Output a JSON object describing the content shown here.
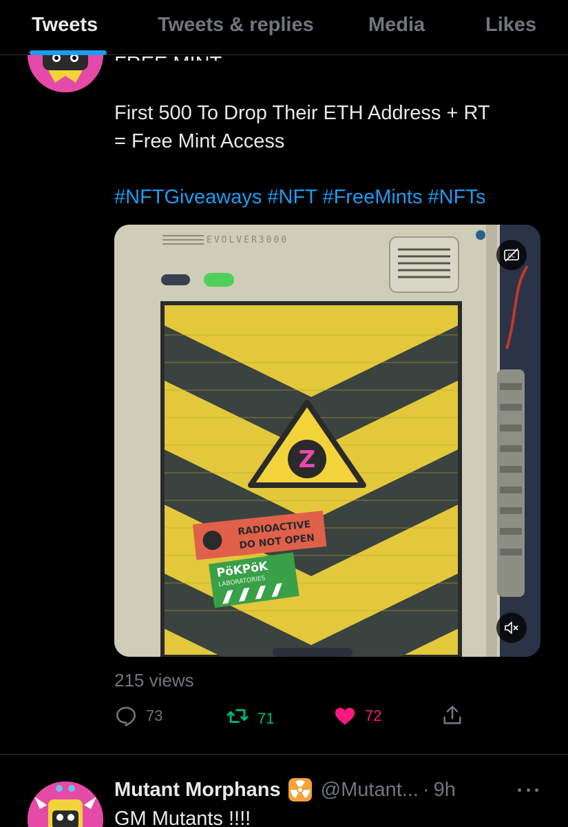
{
  "tabs": [
    {
      "label": "Tweets",
      "active": true
    },
    {
      "label": "Tweets & replies",
      "active": false
    },
    {
      "label": "Media",
      "active": false
    },
    {
      "label": "Likes",
      "active": false
    }
  ],
  "tweet1": {
    "clipped_title": "FREE MINT",
    "text_line1": "First 500 To Drop Their ETH Address + RT",
    "text_line2": "= Free Mint Access",
    "hashtags": [
      "#NFTGiveaways",
      "#NFT",
      "#FreeMints",
      "#NFTs"
    ],
    "media": {
      "header_text": "EVOLVER3000",
      "sticker_line1": "RADIOACTIVE",
      "sticker_line2": "DO NOT OPEN",
      "lab_label": "PöKPöK",
      "lab_sub": "LABORATORIES",
      "emblem_letter": "Z",
      "cc_icon": "closed-captions-icon",
      "mute_icon": "speaker-muted-icon"
    },
    "views": "215 views",
    "replies": "73",
    "retweets": "71",
    "likes": "72",
    "colors": {
      "retweeted": "#00ba7c",
      "liked": "#f91880",
      "link": "#1d9bf0"
    }
  },
  "tweet2": {
    "name": "Mutant Morphans",
    "handle": "@Mutant...",
    "separator": "·",
    "time": "9h",
    "text": "GM Mutants !!!!"
  }
}
